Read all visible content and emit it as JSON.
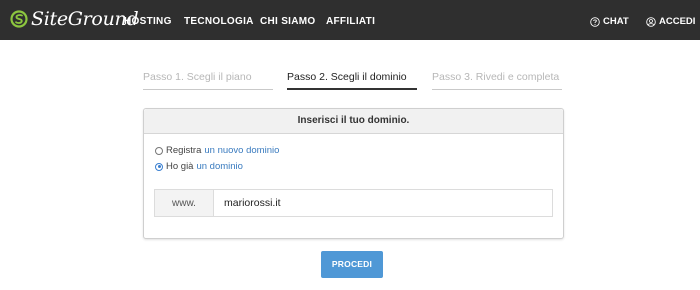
{
  "brand": {
    "name": "SiteGround",
    "color": "#8cc63f"
  },
  "nav": {
    "items": [
      {
        "label": "HOSTING"
      },
      {
        "label": "TECNOLOGIA"
      },
      {
        "label": "CHI SIAMO"
      },
      {
        "label": "AFFILIATI"
      }
    ],
    "chat_label": "CHAT",
    "chat_icon": "help-circle-icon",
    "login_label": "ACCEDI",
    "login_icon": "user-icon"
  },
  "steps": [
    {
      "label": "Passo 1. Scegli il piano",
      "state": "done"
    },
    {
      "label": "Passo 2. Scegli il dominio",
      "state": "active"
    },
    {
      "label": "Passo 3. Rivedi e completa",
      "state": "todo"
    }
  ],
  "card": {
    "title": "Inserisci il tuo dominio.",
    "options": [
      {
        "prefix": "Registra",
        "link": "un nuovo dominio",
        "checked": false
      },
      {
        "prefix": "Ho già",
        "link": "un dominio",
        "checked": true
      }
    ],
    "domain_prefix": "www.",
    "domain_value": "mariorossi.it"
  },
  "submit_label": "PROCEDI",
  "colors": {
    "header": "#2f2f2f",
    "accent": "#4f98d6",
    "link": "#3a7bbf"
  }
}
